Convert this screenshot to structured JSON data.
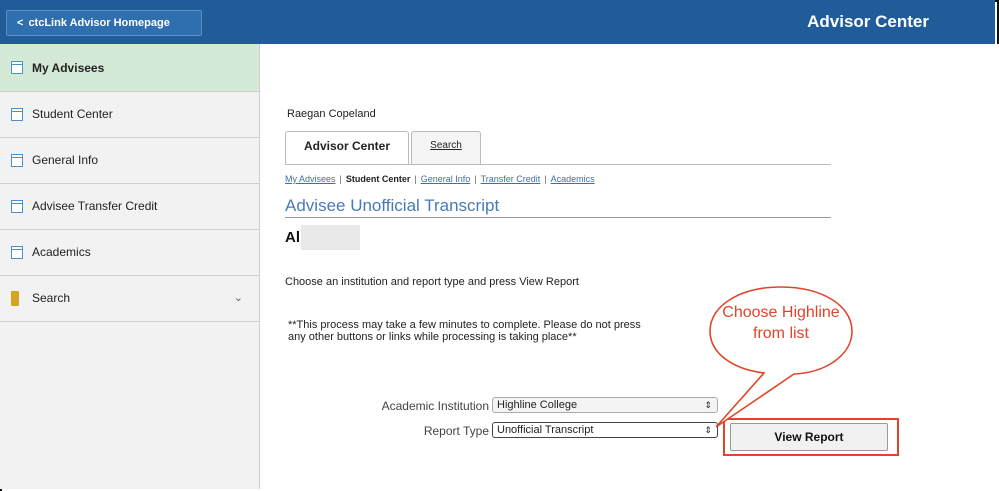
{
  "header": {
    "home_label": "ctcLink Advisor Homepage",
    "title": "Advisor Center"
  },
  "sidebar": {
    "items": [
      {
        "label": "My Advisees",
        "icon": "document-icon",
        "active": true
      },
      {
        "label": "Student Center",
        "icon": "document-icon"
      },
      {
        "label": "General Info",
        "icon": "document-icon"
      },
      {
        "label": "Advisee Transfer Credit",
        "icon": "document-icon"
      },
      {
        "label": "Academics",
        "icon": "document-icon"
      },
      {
        "label": "Search",
        "icon": "folder-icon",
        "expandable": true
      }
    ]
  },
  "main": {
    "student_name": "Raegan Copeland",
    "tabs": [
      {
        "label": "Advisor Center",
        "selected": true
      },
      {
        "label": "Search"
      }
    ],
    "subnav": [
      {
        "label": "My Advisees"
      },
      {
        "label": "Student Center",
        "current": true
      },
      {
        "label": "General Info"
      },
      {
        "label": "Transfer Credit"
      },
      {
        "label": "Academics"
      }
    ],
    "page_title": "Advisee Unofficial Transcript",
    "advisee_name_visible": "Al                 e",
    "instruction": "Choose an institution and report type and press View Report",
    "warning": "**This process may take a few minutes to complete. Please do not press any other buttons or links while processing is taking place**",
    "institution_label": "Academic Institution",
    "institution_value": "Highline College",
    "report_type_label": "Report Type",
    "report_type_value": "Unofficial Transcript",
    "view_report_label": "View Report"
  },
  "annotation": {
    "callout_text": "Choose Highline from list",
    "color": "#e0452a"
  },
  "colors": {
    "header_bg": "#1f5c99",
    "sidebar_active_bg": "#d4ead7",
    "title_color": "#4a7ab5",
    "link_color": "#3a6fb0"
  }
}
